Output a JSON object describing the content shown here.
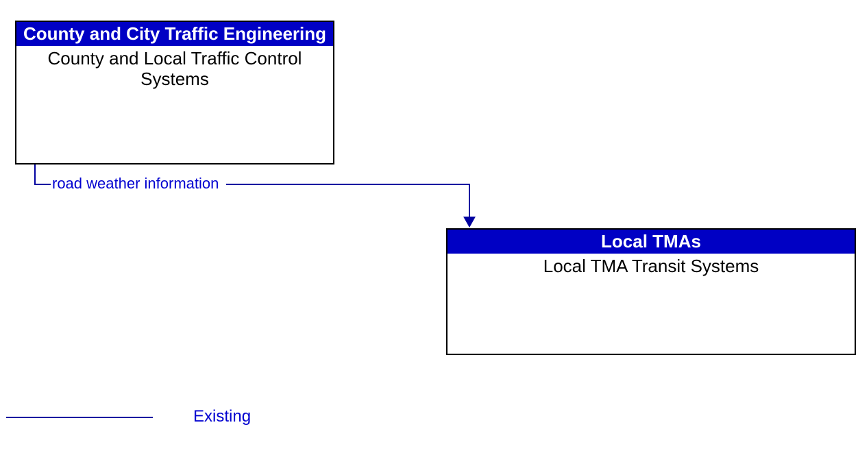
{
  "nodes": {
    "source": {
      "header": "County and City Traffic Engineering",
      "body": "County and Local Traffic Control Systems"
    },
    "target": {
      "header": "Local TMAs",
      "body": "Local TMA Transit Systems"
    }
  },
  "flow": {
    "label": "road weather information"
  },
  "legend": {
    "existing": "Existing"
  },
  "colors": {
    "header_bg": "#0000c4",
    "line": "#0000a0",
    "label": "#0000d0"
  }
}
